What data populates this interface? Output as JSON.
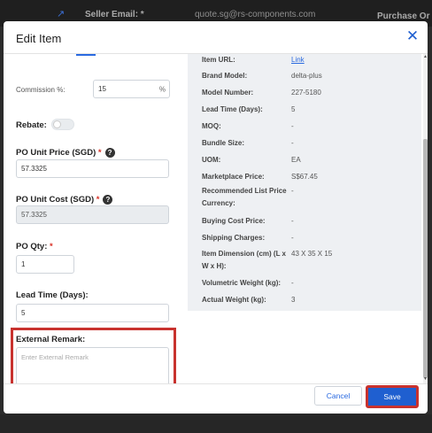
{
  "background": {
    "seller_email_label": "Seller Email: *",
    "seller_email_value": "quote.sg@rs-components.com",
    "purchase_label": "Purchase Or"
  },
  "modal": {
    "title": "Edit Item",
    "close_icon": "close-icon"
  },
  "form": {
    "commission_label": "Commission %:",
    "commission_value": "15",
    "commission_suffix": "%",
    "rebate_label": "Rebate:",
    "rebate_on": false,
    "po_unit_price_label": "PO Unit Price (SGD)",
    "po_unit_price_value": "57.3325",
    "po_unit_cost_label": "PO Unit Cost (SGD)",
    "po_unit_cost_value": "57.3325",
    "po_qty_label": "PO Qty:",
    "po_qty_value": "1",
    "lead_time_label": "Lead Time (Days):",
    "lead_time_value": "5",
    "external_remark_label": "External Remark:",
    "external_remark_placeholder": "Enter External Remark",
    "required_mark": "*"
  },
  "info": {
    "rows": [
      {
        "label": "Item URL:",
        "value": "Link",
        "is_link": true
      },
      {
        "label": "Brand Model:",
        "value": "delta-plus"
      },
      {
        "label": "Model Number:",
        "value": "227-5180"
      },
      {
        "label": "Lead Time (Days):",
        "value": "5"
      },
      {
        "label": "MOQ:",
        "value": "-"
      },
      {
        "label": "Bundle Size:",
        "value": "-"
      },
      {
        "label": "UOM:",
        "value": "EA"
      },
      {
        "label": "Marketplace Price:",
        "value": "S$67.45"
      },
      {
        "label": "Recommended List Price Currency:",
        "value": "-"
      },
      {
        "label": "Buying Cost Price:",
        "value": "-"
      },
      {
        "label": "Shipping Charges:",
        "value": "-"
      },
      {
        "label": "Item Dimension (cm) (L x W x H):",
        "value": "43 X 35 X 15"
      },
      {
        "label": "Volumetric Weight (kg):",
        "value": "-"
      },
      {
        "label": "Actual Weight (kg):",
        "value": "3"
      }
    ]
  },
  "footer": {
    "cancel_label": "Cancel",
    "save_label": "Save"
  },
  "colors": {
    "primary": "#1f5fd0",
    "highlight": "#c8322e",
    "info_bg": "#eef0f3"
  }
}
